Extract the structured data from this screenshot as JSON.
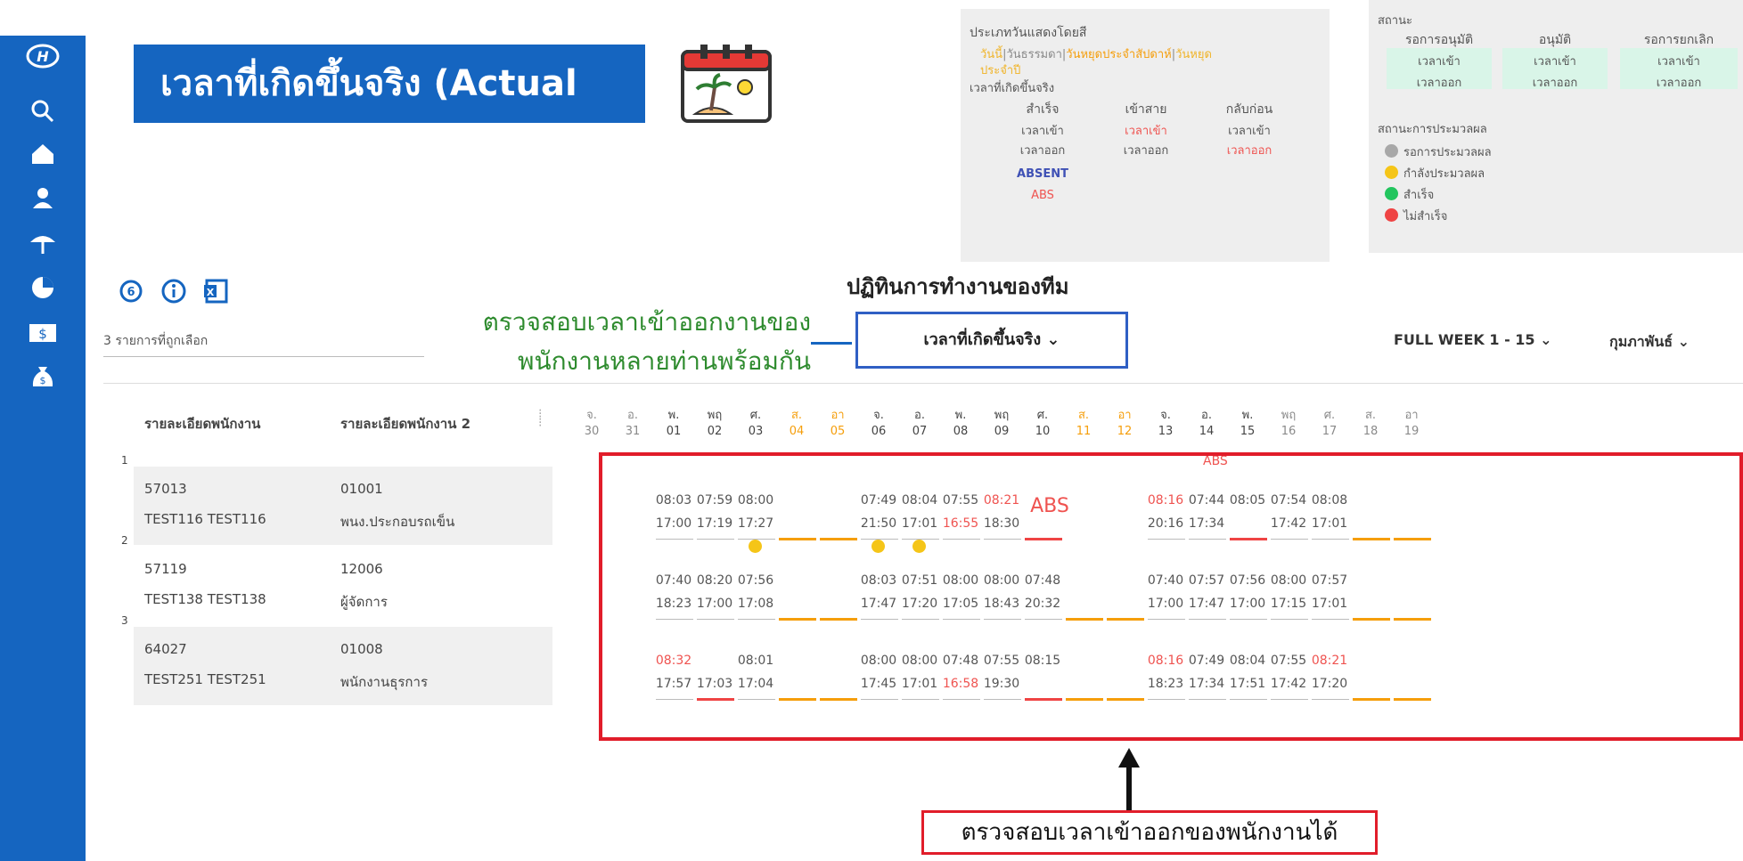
{
  "sidebar": {
    "icons": [
      "hyundai-logo-icon",
      "search-icon",
      "home-icon",
      "person-icon",
      "umbrella-icon",
      "chart-icon",
      "money-icon",
      "money-bag-icon"
    ]
  },
  "banner": {
    "title": "เวลาที่เกิดขึ้นจริง (Actual Time)"
  },
  "legend_color": {
    "title": "ประเภทวันแสดงโดยสี",
    "line1": [
      "วันนี้",
      "|",
      "วันธรรมดา",
      "|",
      "วันหยุดประจำสัปดาห์",
      "|",
      "วันหยุด"
    ],
    "line2": "ประจำปี",
    "actual_label": "เวลาที่เกิดขึ้นจริง",
    "cols": [
      {
        "head": "สำเร็จ",
        "in": "เวลาเข้า",
        "out": "เวลาออก"
      },
      {
        "head": "เข้าสาย",
        "in": "เวลาเข้า",
        "out": "เวลาออก"
      },
      {
        "head": "กลับก่อน",
        "in": "เวลาเข้า",
        "out": "เวลาออก"
      }
    ],
    "absent_label": "ABSENT",
    "abs_short": "ABS"
  },
  "legend_status": {
    "title": "สถานะ",
    "cols": [
      {
        "head": "รอการอนุมัติ",
        "in": "เวลาเข้า",
        "out": "เวลาออก"
      },
      {
        "head": "อนุมัติ",
        "in": "เวลาเข้า",
        "out": "เวลาออก"
      },
      {
        "head": "รอการยกเลิก",
        "in": "เวลาเข้า",
        "out": "เวลาออก"
      }
    ],
    "process_title": "สถานะการประมวลผล",
    "process": [
      {
        "label": "รอการประมวลผล",
        "color": "#a8a8a8"
      },
      {
        "label": "กำลังประมวลผล",
        "color": "#f5c518"
      },
      {
        "label": "สำเร็จ",
        "color": "#22c55e"
      },
      {
        "label": "ไม่สำเร็จ",
        "color": "#ef4444"
      }
    ]
  },
  "toolbar": {
    "icons": [
      "refresh-icon",
      "info-icon",
      "excel-icon"
    ]
  },
  "center_title": "ปฏิทินการทำงานของทีม",
  "selected_count": "3 รายการที่ถูกเลือก",
  "callout_top": {
    "line1": "ตรวจสอบเวลาเข้าออกงานของ",
    "line2": "พนักงานหลายท่านพร้อมกัน"
  },
  "view_dropdown": {
    "label": "เวลาที่เกิดขึ้นจริง ⌄"
  },
  "week_dropdown": {
    "label": "FULL WEEK 1 - 15 ⌄"
  },
  "month_dropdown": {
    "label": "กุมภาพันธ์ ⌄"
  },
  "table": {
    "col1": "รายละเอียดพนักงาน",
    "col2": "รายละเอียดพนักงาน 2",
    "days": [
      {
        "d": "จ.",
        "n": "30",
        "c": "gray"
      },
      {
        "d": "อ.",
        "n": "31",
        "c": "gray"
      },
      {
        "d": "พ.",
        "n": "01",
        "c": "norm"
      },
      {
        "d": "พฤ",
        "n": "02",
        "c": "norm"
      },
      {
        "d": "ศ.",
        "n": "03",
        "c": "norm"
      },
      {
        "d": "ส.",
        "n": "04",
        "c": "orange"
      },
      {
        "d": "อา",
        "n": "05",
        "c": "orange"
      },
      {
        "d": "จ.",
        "n": "06",
        "c": "norm"
      },
      {
        "d": "อ.",
        "n": "07",
        "c": "norm"
      },
      {
        "d": "พ.",
        "n": "08",
        "c": "norm"
      },
      {
        "d": "พฤ",
        "n": "09",
        "c": "norm"
      },
      {
        "d": "ศ.",
        "n": "10",
        "c": "norm"
      },
      {
        "d": "ส.",
        "n": "11",
        "c": "orange"
      },
      {
        "d": "อา",
        "n": "12",
        "c": "orange"
      },
      {
        "d": "จ.",
        "n": "13",
        "c": "norm"
      },
      {
        "d": "อ.",
        "n": "14",
        "c": "norm"
      },
      {
        "d": "พ.",
        "n": "15",
        "c": "norm"
      },
      {
        "d": "พฤ",
        "n": "16",
        "c": "gray"
      },
      {
        "d": "ศ.",
        "n": "17",
        "c": "gray"
      },
      {
        "d": "ส.",
        "n": "18",
        "c": "gray"
      },
      {
        "d": "อา",
        "n": "19",
        "c": "gray"
      }
    ],
    "header_abs": "ABS",
    "rows": [
      {
        "num": "1",
        "id": "57013",
        "name": "TEST116 TEST116",
        "code": "01001",
        "dept": "พนง.ประกอบรถเข็น",
        "in": [
          "",
          "",
          "08:03",
          "07:59",
          "08:00",
          "",
          "",
          "07:49",
          "08:04",
          "07:55",
          "08:21",
          "",
          "",
          "",
          "08:16",
          "07:44",
          "08:05",
          "07:54",
          "08:08",
          "",
          ""
        ],
        "out": [
          "",
          "",
          "17:00",
          "17:19",
          "17:27",
          "",
          "",
          "21:50",
          "17:01",
          "16:55",
          "18:30",
          "",
          "",
          "",
          "20:16",
          "17:34",
          "",
          "17:42",
          "17:01",
          "",
          ""
        ],
        "in_red": [
          10,
          14
        ],
        "out_red": [
          9
        ],
        "abs_day": 11,
        "abs_text": "ABS",
        "dots": [],
        "bars": [
          "",
          "",
          "",
          "",
          "",
          "o",
          "o",
          "",
          "",
          "",
          "",
          "r",
          "",
          "",
          "",
          "",
          "r",
          "",
          "",
          "o",
          "o"
        ]
      },
      {
        "num": "2",
        "id": "57119",
        "name": "TEST138 TEST138",
        "code": "12006",
        "dept": "ผู้จัดการ",
        "in": [
          "",
          "",
          "07:40",
          "08:20",
          "07:56",
          "",
          "",
          "08:03",
          "07:51",
          "08:00",
          "08:00",
          "07:48",
          "",
          "",
          "07:40",
          "07:57",
          "07:56",
          "08:00",
          "07:57",
          "",
          ""
        ],
        "out": [
          "",
          "",
          "18:23",
          "17:00",
          "17:08",
          "",
          "",
          "17:47",
          "17:20",
          "17:05",
          "18:43",
          "20:32",
          "",
          "",
          "17:00",
          "17:47",
          "17:00",
          "17:15",
          "17:01",
          "",
          ""
        ],
        "in_red": [],
        "out_red": [],
        "dots": [
          4,
          7,
          8
        ],
        "bars": [
          "",
          "",
          "",
          "",
          "",
          "o",
          "o",
          "",
          "",
          "",
          "",
          "",
          "o",
          "o",
          "",
          "",
          "",
          "",
          "",
          "o",
          "o"
        ]
      },
      {
        "num": "3",
        "id": "64027",
        "name": "TEST251 TEST251",
        "code": "01008",
        "dept": "พนักงานธุรการ",
        "in": [
          "",
          "",
          "08:32",
          "",
          "08:01",
          "",
          "",
          "08:00",
          "08:00",
          "07:48",
          "07:55",
          "08:15",
          "",
          "",
          "08:16",
          "07:49",
          "08:04",
          "07:55",
          "08:21",
          "",
          ""
        ],
        "out": [
          "",
          "",
          "17:57",
          "17:03",
          "17:04",
          "",
          "",
          "17:45",
          "17:01",
          "16:58",
          "19:30",
          "",
          "",
          "",
          "18:23",
          "17:34",
          "17:51",
          "17:42",
          "17:20",
          "",
          ""
        ],
        "in_red": [
          2,
          14,
          18
        ],
        "out_red": [
          9
        ],
        "dots": [],
        "bars": [
          "",
          "",
          "",
          "r",
          "",
          "o",
          "o",
          "",
          "",
          "",
          "",
          "r",
          "o",
          "o",
          "",
          "",
          "",
          "",
          "",
          "o",
          "o"
        ]
      }
    ]
  },
  "callout_bottom": "ตรวจสอบเวลาเข้าออกของพนักงานได้"
}
